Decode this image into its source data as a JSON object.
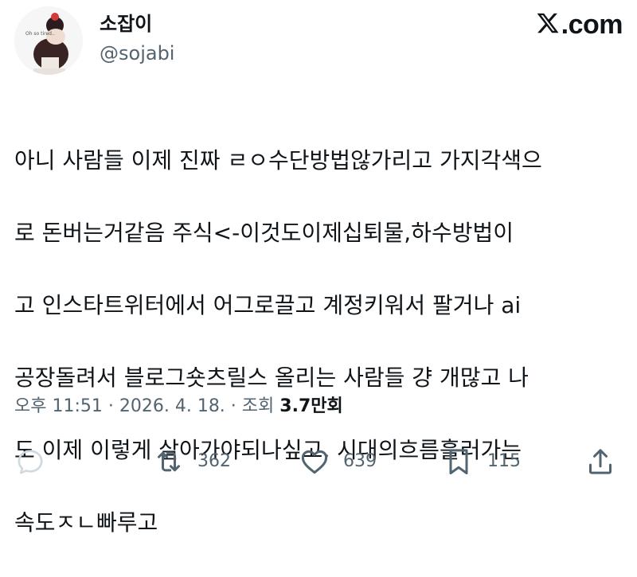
{
  "author": {
    "display_name": "소잡이",
    "handle": "@sojabi",
    "avatar_text": "Oh so tired.."
  },
  "brand": {
    "text": ".com",
    "icon": "x-logo-icon"
  },
  "tweet": {
    "lines": [
      "아니 사람들 이제 진짜 ㄹㅇ수단방법않가리고 가지각색으",
      "로 돈버는거같음   주식<-이것도이제십퇴물,하수방법이",
      "고  인스타트위터에서 어그로끌고 계정키워서 팔거나 ai",
      "공장돌려서 블로그숏츠릴스 올리는 사람들 걍 개많고  나",
      "도 이제 이렇게 살아가야되나싶고,  시대의흐름흘러가는",
      "속도ㅈㄴ빠루고"
    ]
  },
  "meta": {
    "time": "오후 11:51",
    "separator": " · ",
    "date": "2026. 4. 18.",
    "views_label": "조회 ",
    "views_count": "3.7",
    "views_unit": "만회"
  },
  "actions": {
    "reply": {
      "icon": "reply-icon",
      "count": ""
    },
    "retweet": {
      "icon": "retweet-icon",
      "count": "362"
    },
    "like": {
      "icon": "heart-icon",
      "count": "639"
    },
    "bookmark": {
      "icon": "bookmark-icon",
      "count": "115"
    },
    "share": {
      "icon": "share-icon",
      "count": ""
    }
  },
  "colors": {
    "text_primary": "#0f1419",
    "text_secondary": "#536471",
    "icon_light": "#cfd9de",
    "background": "#ffffff"
  }
}
